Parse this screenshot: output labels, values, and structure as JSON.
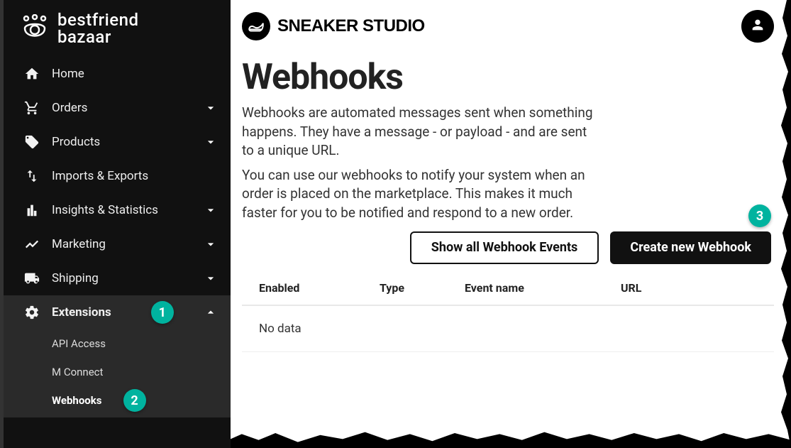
{
  "logo": {
    "line1": "bestfriend",
    "line2": "bazaar"
  },
  "sidebar": {
    "items": [
      {
        "label": "Home"
      },
      {
        "label": "Orders"
      },
      {
        "label": "Products"
      },
      {
        "label": "Imports & Exports"
      },
      {
        "label": "Insights & Statistics"
      },
      {
        "label": "Marketing"
      },
      {
        "label": "Shipping"
      },
      {
        "label": "Extensions"
      }
    ],
    "sub": [
      {
        "label": "API Access"
      },
      {
        "label": "M Connect"
      },
      {
        "label": "Webhooks"
      }
    ]
  },
  "brand": {
    "name": "SNEAKER STUDIO"
  },
  "page": {
    "title": "Webhooks",
    "desc1": "Webhooks are automated messages sent when something happens. They have a message - or payload - and are sent to a unique URL.",
    "desc2": "You can use our webhooks to notify your system when an order is placed on the marketplace. This makes it much faster for you to be notified and respond to a new order."
  },
  "buttons": {
    "show_all": "Show all Webhook Events",
    "create": "Create new Webhook"
  },
  "table": {
    "columns": {
      "enabled": "Enabled",
      "type": "Type",
      "event": "Event name",
      "url": "URL"
    },
    "empty": "No data"
  },
  "badges": {
    "b1": "1",
    "b2": "2",
    "b3": "3"
  }
}
